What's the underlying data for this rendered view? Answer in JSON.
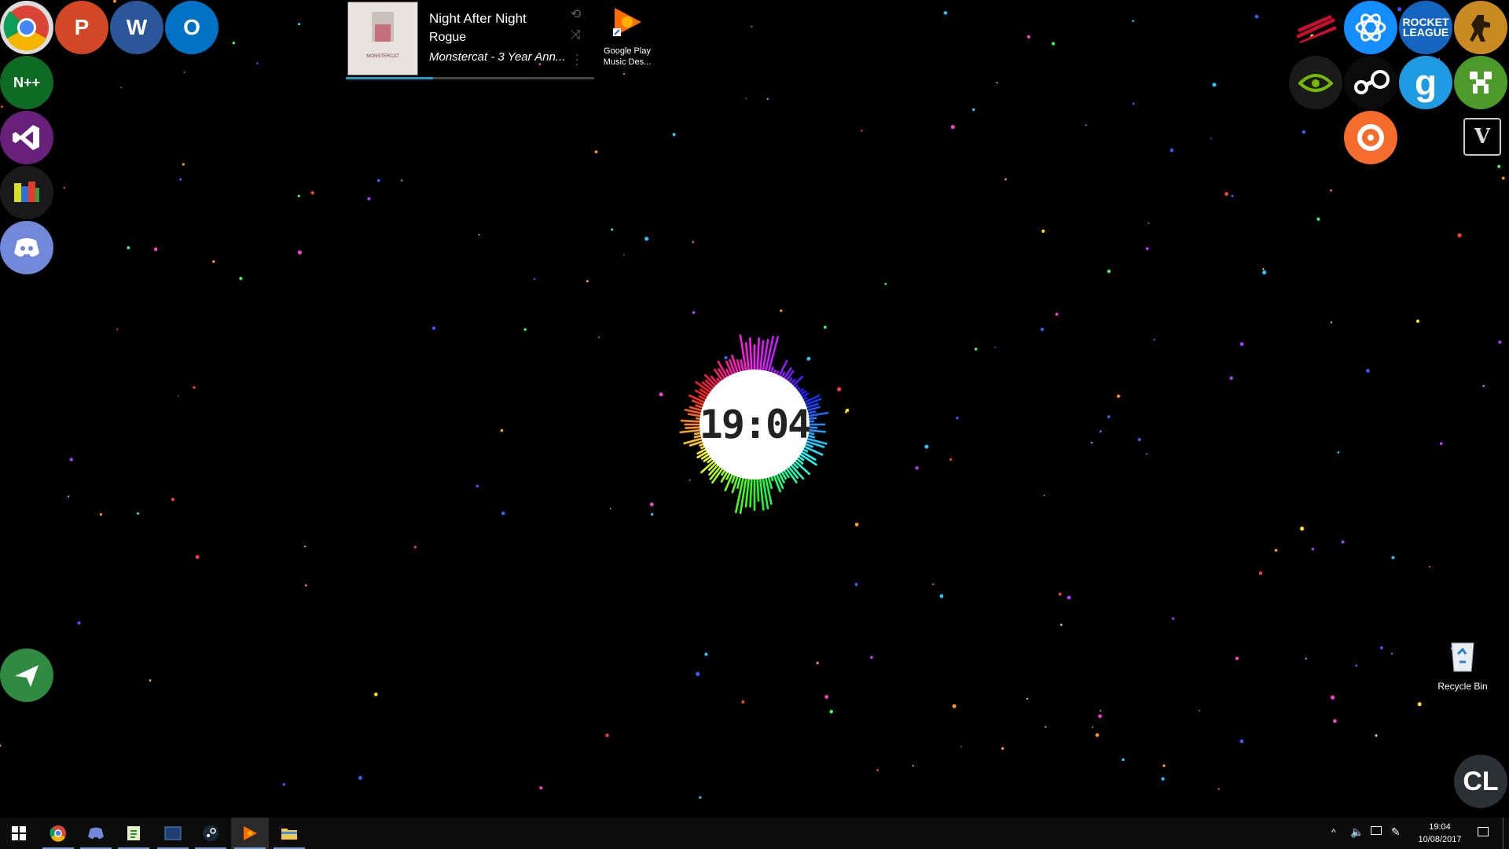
{
  "music_widget": {
    "album_art_text": "MONSTERCAT",
    "title": "Night After Night",
    "artist": "Rogue",
    "album": "Monstercat - 3 Year Ann...",
    "progress": 0.35,
    "accent": "#1ba1c7"
  },
  "desktop_shortcut": {
    "label_line1": "Google Play",
    "label_line2": "Music Des..."
  },
  "clock_widget": {
    "time": "19:04"
  },
  "recycle_bin": {
    "label": "Recycle Bin"
  },
  "left_dock": [
    {
      "name": "chrome-icon"
    },
    {
      "name": "powerpoint-icon"
    },
    {
      "name": "word-icon"
    },
    {
      "name": "outlook-icon"
    },
    {
      "name": "notepadpp-icon"
    },
    {
      "name": "visual-studio-icon"
    },
    {
      "name": "avg-icon"
    },
    {
      "name": "discord-icon"
    },
    {
      "name": "airplane-icon"
    }
  ],
  "right_dock": [
    {
      "name": "madcatz-icon"
    },
    {
      "name": "battlenet-icon"
    },
    {
      "name": "rocket-league-icon",
      "text": "ROCKET\nLEAGUE"
    },
    {
      "name": "counter-strike-icon"
    },
    {
      "name": "nvidia-icon"
    },
    {
      "name": "steam-icon"
    },
    {
      "name": "gmod-icon",
      "text": "g"
    },
    {
      "name": "minecraft-icon"
    },
    {
      "name": "origin-icon"
    },
    {
      "name": "gta-v-icon",
      "text": "V"
    },
    {
      "name": "cl-icon",
      "text": "CL"
    }
  ],
  "taskbar": {
    "apps": [
      {
        "name": "taskbar-start-icon"
      },
      {
        "name": "taskbar-chrome-icon"
      },
      {
        "name": "taskbar-discord-icon"
      },
      {
        "name": "taskbar-notepadpp-icon"
      },
      {
        "name": "taskbar-media-icon"
      },
      {
        "name": "taskbar-steam-icon"
      },
      {
        "name": "taskbar-gpm-icon"
      },
      {
        "name": "taskbar-explorer-icon"
      }
    ],
    "tray_time": "19:04",
    "tray_date": "10/08/2017"
  }
}
